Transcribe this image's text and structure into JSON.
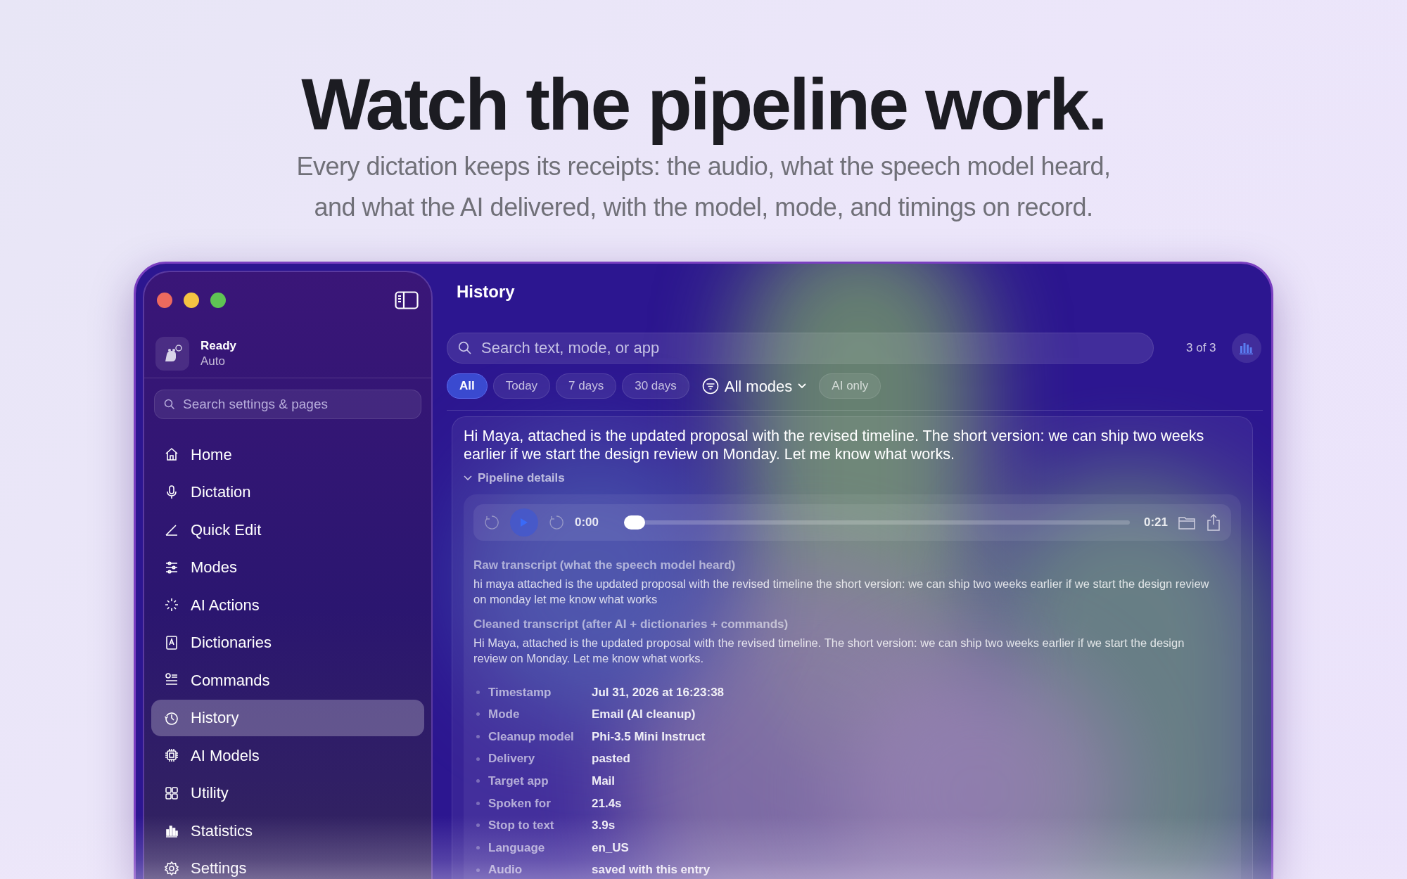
{
  "hero": {
    "headline": "Watch the pipeline work.",
    "subtitle": "Every dictation keeps its receipts: the audio, what the speech model heard,\nand what the AI delivered, with the model, mode, and timings on record."
  },
  "sidebar": {
    "status": {
      "title": "Ready",
      "subtitle": "Auto"
    },
    "search": {
      "placeholder": "Search settings & pages"
    },
    "items": [
      {
        "label": "Home",
        "selected": false
      },
      {
        "label": "Dictation",
        "selected": false
      },
      {
        "label": "Quick Edit",
        "selected": false
      },
      {
        "label": "Modes",
        "selected": false
      },
      {
        "label": "AI Actions",
        "selected": false
      },
      {
        "label": "Dictionaries",
        "selected": false
      },
      {
        "label": "Commands",
        "selected": false
      },
      {
        "label": "History",
        "selected": true
      },
      {
        "label": "AI Models",
        "selected": false
      },
      {
        "label": "Utility",
        "selected": false
      },
      {
        "label": "Statistics",
        "selected": false
      },
      {
        "label": "Settings",
        "selected": false
      }
    ]
  },
  "main": {
    "title": "History",
    "search": {
      "placeholder": "Search text, mode, or app"
    },
    "count": "3 of 3",
    "filters": [
      {
        "kind": "chip",
        "label": "All",
        "selected": true
      },
      {
        "kind": "chip",
        "label": "Today",
        "selected": false
      },
      {
        "kind": "chip",
        "label": "7 days",
        "selected": false
      },
      {
        "kind": "chip",
        "label": "30 days",
        "selected": false
      },
      {
        "kind": "dropdown",
        "label": "All modes",
        "selected": false
      },
      {
        "kind": "chip",
        "label": "AI only",
        "selected": false
      }
    ],
    "entry": {
      "text": "Hi Maya, attached is the updated proposal with the revised timeline. The short version: we can ship two weeks earlier if we start the design review on Monday. Let me know what works.",
      "details_toggle": {
        "label": "Pipeline details",
        "expanded": true
      },
      "player": {
        "current": "0:00",
        "total": "0:21",
        "level": 0
      },
      "transcripts": [
        {
          "label": "Raw transcript (what the speech model heard)",
          "text": "hi maya attached is the updated proposal with the revised timeline the short version: we can ship two weeks earlier if we start the design review on monday let me know what works"
        },
        {
          "label": "Cleaned transcript (after AI + dictionaries + commands)",
          "text": "Hi Maya, attached is the updated proposal with the revised timeline. The short version: we can ship two weeks earlier if we start the design review on Monday. Let me know what works."
        }
      ],
      "details": [
        {
          "label": "Timestamp",
          "value": "Jul 31, 2026 at 16:23:38"
        },
        {
          "label": "Mode",
          "value": "Email (AI cleanup)"
        },
        {
          "label": "Cleanup model",
          "value": "Phi-3.5 Mini Instruct"
        },
        {
          "label": "Delivery",
          "value": "pasted"
        },
        {
          "label": "Target app",
          "value": "Mail"
        },
        {
          "label": "Spoken for",
          "value": "21.4s"
        },
        {
          "label": "Stop to text",
          "value": "3.9s"
        },
        {
          "label": "Language",
          "value": "en_US"
        },
        {
          "label": "Audio",
          "value": "saved with this entry"
        }
      ]
    }
  }
}
